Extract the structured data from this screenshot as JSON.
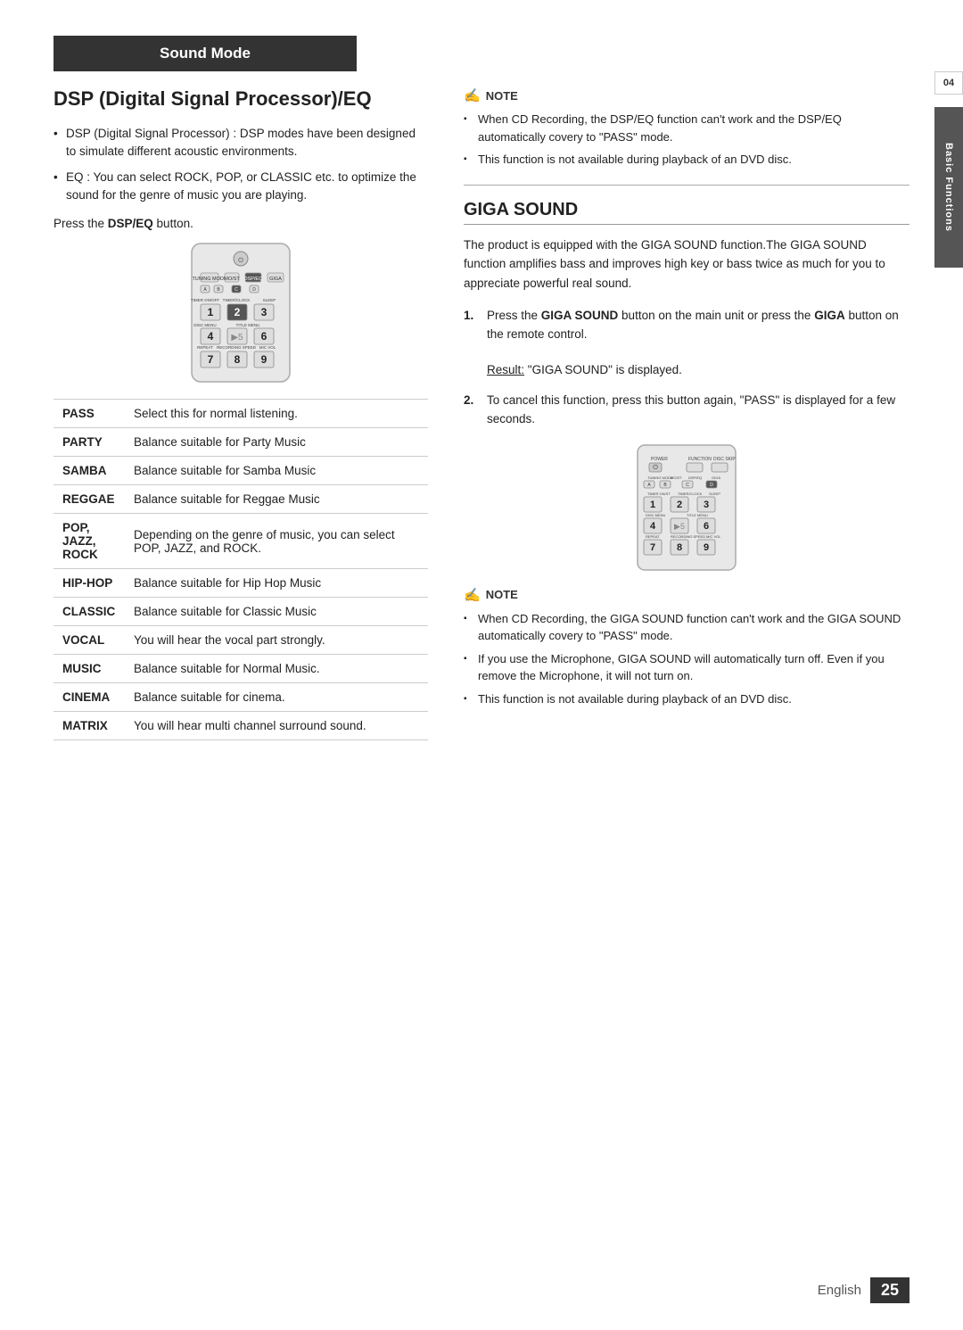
{
  "page": {
    "section_number": "04",
    "section_label": "Basic Functions",
    "footer_lang": "English",
    "footer_page": "25"
  },
  "sound_mode": {
    "header": "Sound Mode",
    "title": "DSP (Digital Signal Processor)/EQ",
    "bullets": [
      "DSP (Digital Signal Processor) : DSP modes have been designed to simulate different acoustic environments.",
      "EQ : You can select ROCK, POP, or CLASSIC etc. to optimize the sound for the genre of music you are playing."
    ],
    "press_text": "Press the DSP/EQ button.",
    "table": {
      "rows": [
        {
          "mode": "PASS",
          "description": "Select this for normal listening."
        },
        {
          "mode": "PARTY",
          "description": "Balance suitable for Party Music"
        },
        {
          "mode": "SAMBA",
          "description": "Balance suitable for Samba Music"
        },
        {
          "mode": "REGGAE",
          "description": "Balance suitable for Reggae Music"
        },
        {
          "mode": "POP,\nJAZZ,\nROCK",
          "description": "Depending on the genre of music, you can select POP, JAZZ, and ROCK."
        },
        {
          "mode": "HIP-HOP",
          "description": "Balance suitable for Hip Hop Music"
        },
        {
          "mode": "CLASSIC",
          "description": "Balance suitable for Classic Music"
        },
        {
          "mode": "VOCAL",
          "description": "You will hear the vocal part strongly."
        },
        {
          "mode": "MUSIC",
          "description": "Balance suitable for Normal Music."
        },
        {
          "mode": "CINEMA",
          "description": "Balance suitable for cinema."
        },
        {
          "mode": "MATRIX",
          "description": "You will hear multi channel surround sound."
        }
      ]
    }
  },
  "note_right": {
    "label": "NOTE",
    "items": [
      "When CD Recording, the DSP/EQ function can't work and the DSP/EQ automatically covery to \"PASS\" mode.",
      "This function is not available during playback of an DVD disc."
    ]
  },
  "giga_sound": {
    "title": "GIGA SOUND",
    "body": "The product is equipped with the GIGA SOUND function.The GIGA SOUND function amplifies bass and improves high key or bass twice as much for you to appreciate powerful real sound.",
    "steps": [
      {
        "number": "1.",
        "text": "Press the GIGA SOUND button on the main unit or press the GIGA button on the remote control.",
        "result_label": "Result:",
        "result_text": "\"GIGA SOUND\" is displayed."
      },
      {
        "number": "2.",
        "text": "To cancel this function, press this button again, \"PASS\" is displayed for a few seconds."
      }
    ]
  },
  "note_bottom": {
    "label": "NOTE",
    "items": [
      "When CD Recording, the GIGA SOUND function can't work and the GIGA SOUND automatically covery to \"PASS\" mode.",
      "If you use the Microphone, GIGA SOUND will automatically turn off. Even if you remove the Microphone, it will not turn on.",
      "This function is not available during playback of an DVD disc."
    ]
  }
}
